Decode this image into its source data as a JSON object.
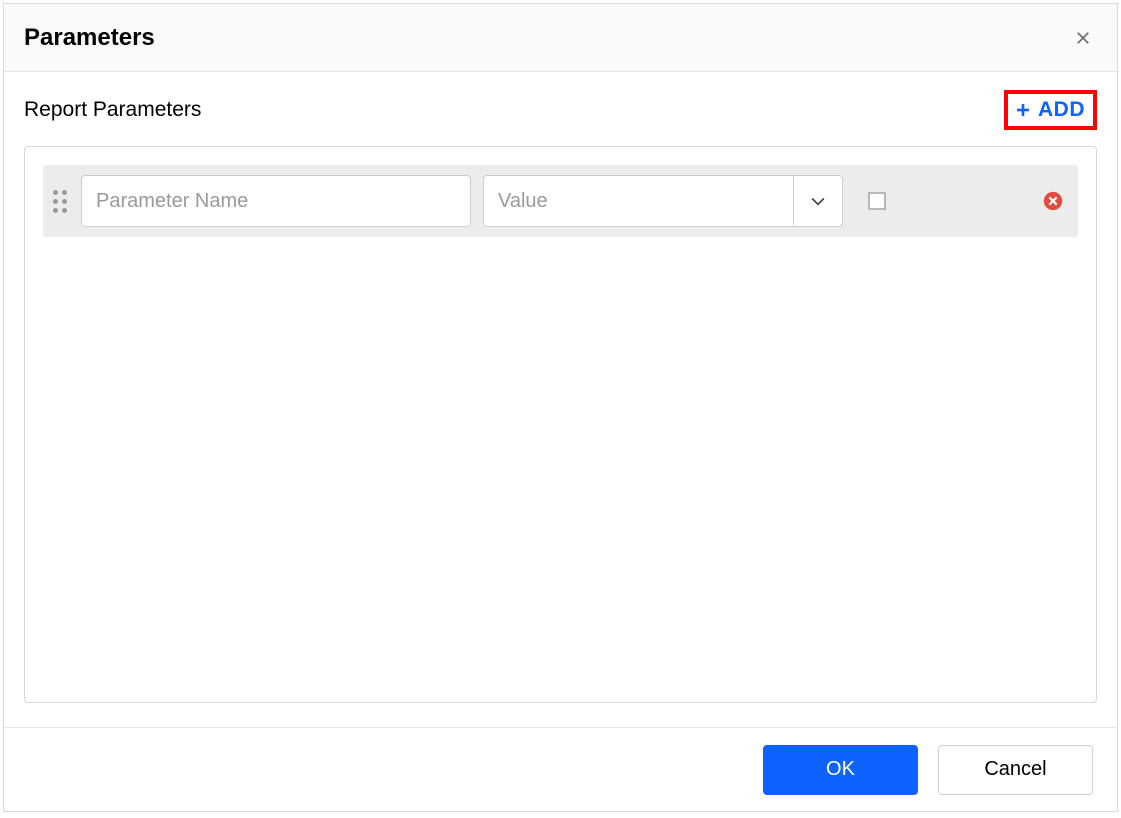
{
  "dialog": {
    "title": "Parameters"
  },
  "section": {
    "title": "Report Parameters",
    "add_label": "ADD"
  },
  "rows": [
    {
      "name_placeholder": "Parameter Name",
      "name_value": "",
      "value_placeholder": "Value",
      "value_value": "",
      "checked": false
    }
  ],
  "footer": {
    "ok_label": "OK",
    "cancel_label": "Cancel"
  }
}
